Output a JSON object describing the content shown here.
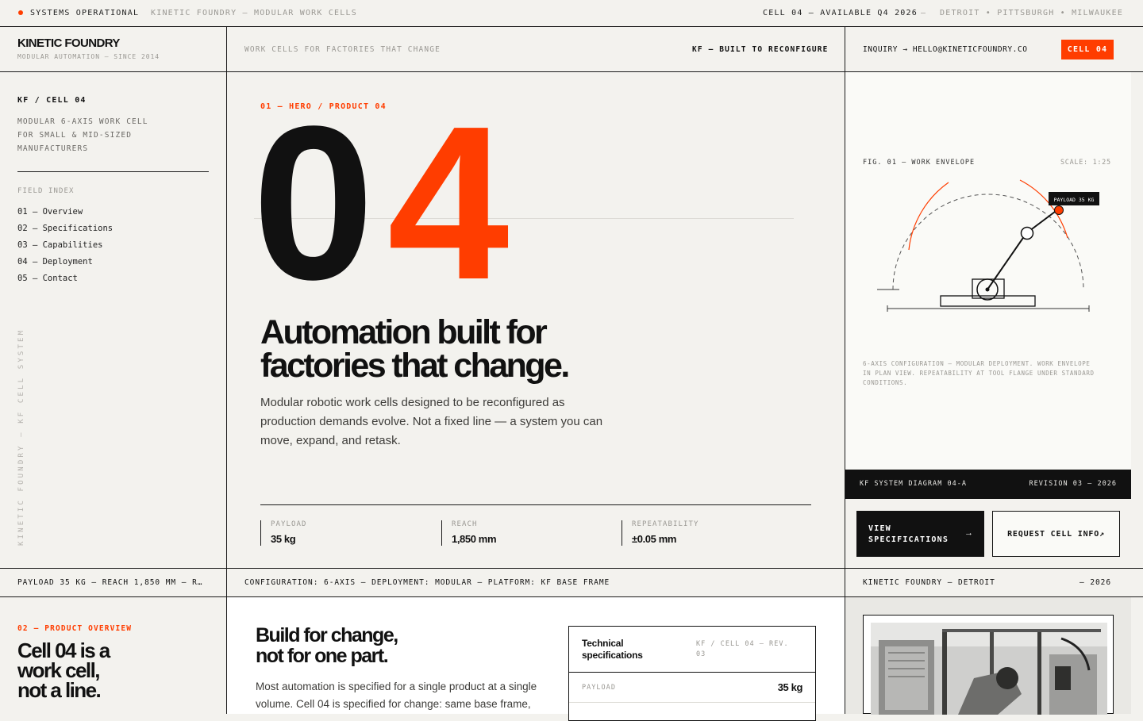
{
  "topbar": {
    "status": "SYSTEMS OPERATIONAL",
    "brand_line": "KINETIC FOUNDRY — MODULAR WORK CELLS",
    "availability": "CELL 04 — AVAILABLE Q4 2026",
    "separator": "—",
    "locations": "DETROIT • PITTSBURGH • MILWAUKEE"
  },
  "header": {
    "logo": "KINETIC FOUNDRY",
    "logo_sub": "MODULAR AUTOMATION — SINCE 2014",
    "tagline": "WORK CELLS FOR FACTORIES THAT CHANGE",
    "slogan": "KF — BUILT TO RECONFIGURE",
    "inquiry": "INQUIRY → HELLO@KINETICFOUNDRY.CO",
    "cell_button": "CELL 04"
  },
  "sidebar": {
    "id": "KF / CELL 04",
    "description": [
      "MODULAR 6-AXIS WORK CELL",
      "FOR SMALL & MID-SIZED",
      "MANUFACTURERS"
    ],
    "index_title": "FIELD INDEX",
    "items": [
      {
        "label": "01 — Overview"
      },
      {
        "label": "02 — Specifications"
      },
      {
        "label": "03 — Capabilities"
      },
      {
        "label": "04 — Deployment"
      },
      {
        "label": "05 — Contact"
      }
    ],
    "vertical_text": "KINETIC FOUNDRY — KF CELL SYSTEM"
  },
  "hero": {
    "eyebrow": "01 — HERO / PRODUCT 04",
    "number_a": "0",
    "number_b": "4",
    "headline_1": "Automation built for",
    "headline_2": "factories that change.",
    "body_1": "Modular robotic work cells designed to be reconfigured as",
    "body_2": "production demands evolve. Not a fixed line — a system you can",
    "body_3": "move, expand, and retask.",
    "stats": [
      {
        "label": "PAYLOAD",
        "value": "35 kg"
      },
      {
        "label": "REACH",
        "value": "1,850 mm"
      },
      {
        "label": "REPEATABILITY",
        "value": "±0.05 mm"
      }
    ]
  },
  "figure": {
    "title": "FIG. 01 — WORK ENVELOPE",
    "scale": "SCALE: 1:25",
    "payload_tag": "PAYLOAD 35 KG",
    "caption_1": "6-AXIS CONFIGURATION — MODULAR DEPLOYMENT. WORK ENVELOPE",
    "caption_2": "IN PLAN VIEW. REPEATABILITY AT TOOL FLANGE UNDER STANDARD",
    "caption_3": "CONDITIONS.",
    "diagram_label": "KF SYSTEM DIAGRAM 04-A",
    "revision": "REVISION 03 — 2026",
    "btn_specs_1": "VIEW",
    "btn_specs_2": "SPECIFICATIONS",
    "btn_specs_arrow": "→",
    "btn_request": "REQUEST CELL INFO↗"
  },
  "ticker": {
    "left": "PAYLOAD 35 KG — REACH 1,850 MM — R…",
    "mid": "CONFIGURATION: 6-AXIS — DEPLOYMENT: MODULAR — PLATFORM: KF BASE FRAME",
    "right": "KINETIC FOUNDRY — DETROIT",
    "year": "— 2026"
  },
  "overview": {
    "eyebrow": "02 — PRODUCT OVERVIEW",
    "title_1": "Cell 04 is a",
    "title_2": "work cell,",
    "title_3": "not a line.",
    "heading_1": "Build for change,",
    "heading_2": "not for one part.",
    "body_1": "Most automation is specified for a single product at a single",
    "body_2": "volume. Cell 04 is specified for change: same base frame,"
  },
  "spec_table": {
    "title_1": "Technical",
    "title_2": "specifications",
    "ref_1": "KF / CELL 04 — REV.",
    "ref_2": "03",
    "rows": [
      {
        "label": "PAYLOAD",
        "value": "35 kg"
      }
    ]
  },
  "colors": {
    "accent": "#ff3d00",
    "ink": "#111111",
    "paper": "#f3f2ee",
    "dark": "#111111"
  }
}
